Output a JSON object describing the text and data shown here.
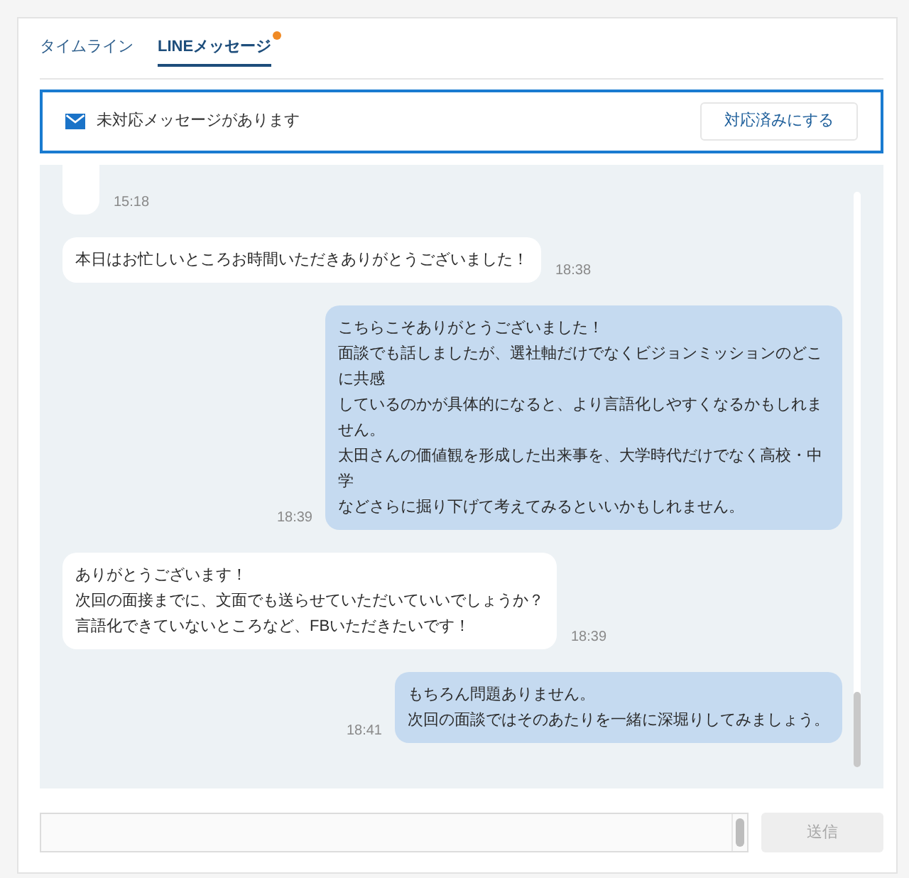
{
  "tabs": [
    {
      "label": "タイムライン",
      "selected": false,
      "unread": false
    },
    {
      "label": "LINEメッセージ",
      "selected": true,
      "unread": true
    }
  ],
  "alert": {
    "text": "未対応メッセージがあります",
    "button": "対応済みにする"
  },
  "messages": [
    {
      "kind": "incoming",
      "time": "15:18"
    },
    {
      "kind": "incoming",
      "lines": [
        "本日はお忙しいところお時間いただきありがとうございました！"
      ],
      "time": "18:38"
    },
    {
      "kind": "outgoing",
      "lines": [
        "こちらこそありがとうございました！",
        "面談でも話しましたが、選社軸だけでなくビジョンミッションのどこに共感",
        "しているのかが具体的になると、より言語化しやすくなるかもしれません。",
        "太田さんの価値観を形成した出来事を、大学時代だけでなく高校・中学",
        "などさらに掘り下げて考えてみるといいかもしれません。"
      ],
      "time": "18:39"
    },
    {
      "kind": "incoming",
      "lines": [
        "ありがとうございます！",
        "次回の面接までに、文面でも送らせていただいていいでしょうか？",
        "言語化できていないところなど、FBいただきたいです！"
      ],
      "time": "18:39"
    },
    {
      "kind": "outgoing",
      "lines": [
        "もちろん問題ありません。",
        "次回の面談ではそのあたりを一緒に深堀りしてみましょう。"
      ],
      "time": "18:41"
    }
  ],
  "composer": {
    "send_button": {
      "label": "送信",
      "disabled": true
    }
  }
}
